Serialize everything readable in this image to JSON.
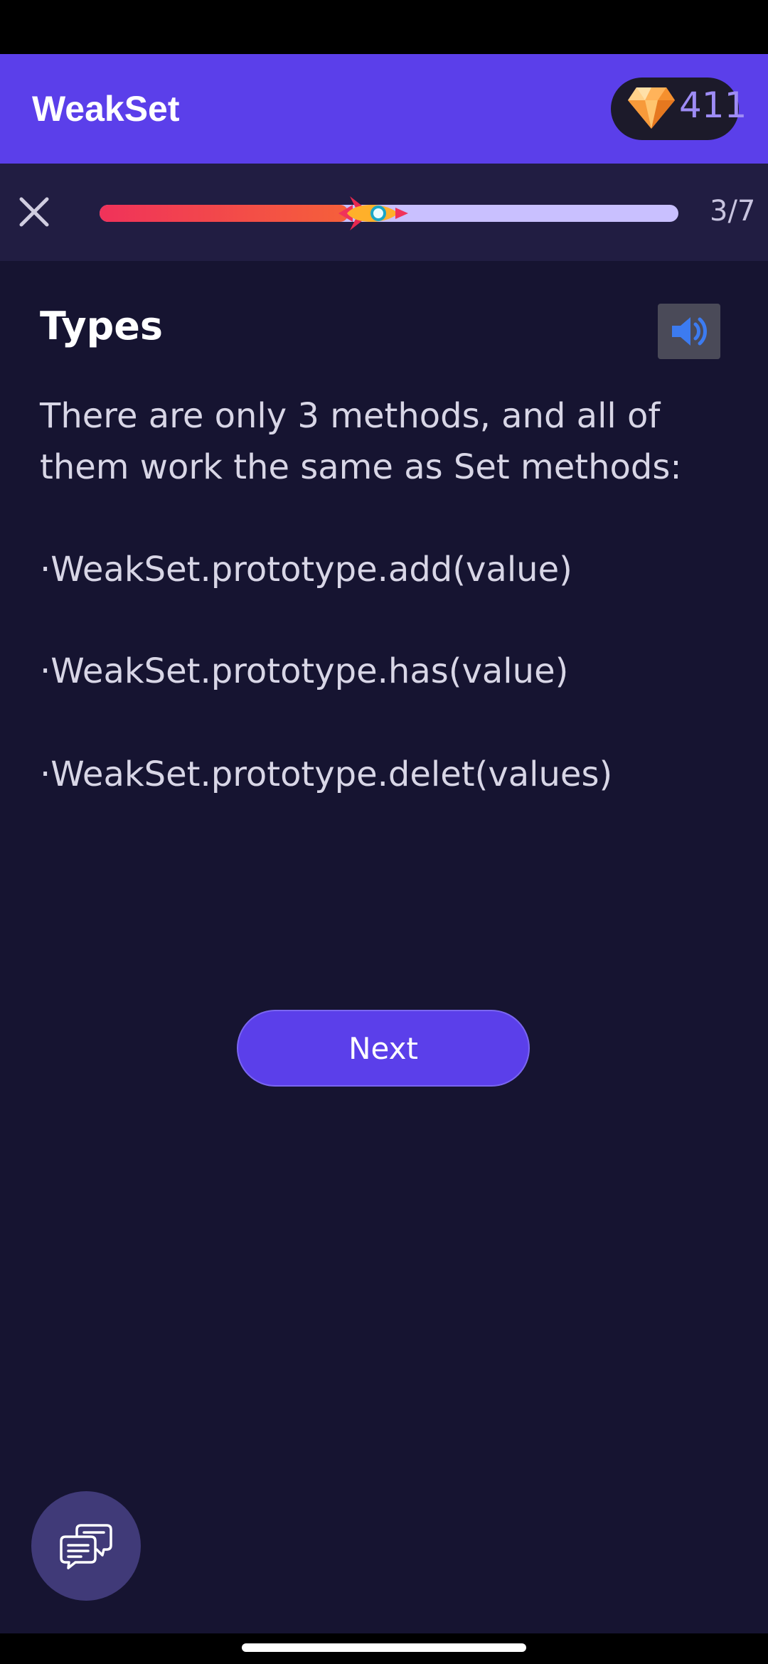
{
  "app_bar": {
    "title": "WeakSet",
    "gems": "411",
    "gem_icon": "gem-icon"
  },
  "progress": {
    "text": "3/7",
    "fraction": 0.43,
    "close_icon": "close-icon",
    "marker_icon": "rocket-icon"
  },
  "lesson": {
    "title": "Types",
    "audio_icon": "speaker-icon",
    "intro": "There are only 3 methods, and all of them work the same as Set methods:",
    "methods": [
      "·WeakSet.prototype.add(value)",
      "·WeakSet.prototype.has(value)",
      "·WeakSet.prototype.delet(values)"
    ]
  },
  "actions": {
    "next_label": "Next",
    "chat_icon": "chat-bubbles-icon"
  },
  "colors": {
    "brand": "#5b3fea",
    "background": "#161431",
    "progress_start": "#f0325a",
    "progress_track": "#c9c0ff"
  }
}
